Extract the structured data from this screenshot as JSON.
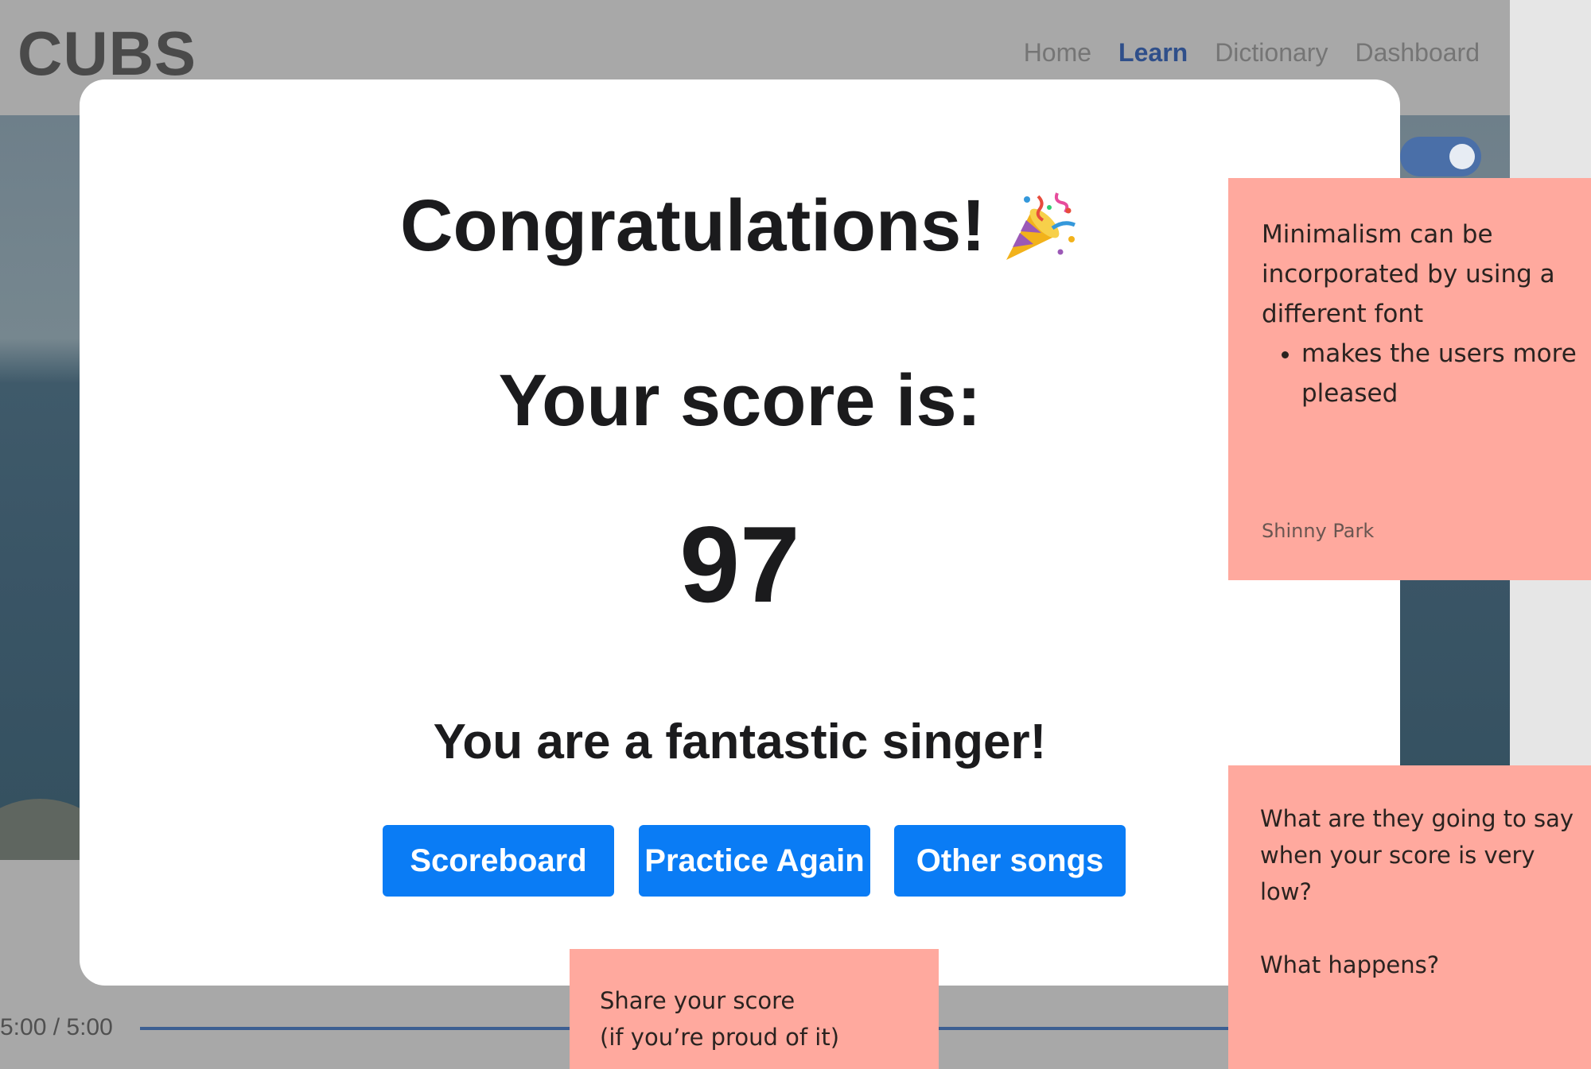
{
  "app": {
    "logo": "CUBS",
    "nav": [
      "Home",
      "Learn",
      "Dictionary",
      "Dashboard"
    ],
    "active_nav": "Learn",
    "playback_time": "5:00 / 5:00",
    "playback_progress": 1.0
  },
  "modal": {
    "title": "Congratulations!",
    "title_icon": "party-popper-icon",
    "score_label": "Your score is:",
    "score": "97",
    "message": "You are a fantastic singer!",
    "buttons": {
      "scoreboard": "Scoreboard",
      "practice_again": "Practice Again",
      "other_songs": "Other songs"
    }
  },
  "notes": {
    "note1": {
      "line1": "Minimalism can be",
      "line2": "incorporated by using a",
      "line3": "different font",
      "bullet_line1": "makes the users more",
      "bullet_line2": "pleased",
      "author": "Shinny Park"
    },
    "note2": {
      "line1": "What are they going to say",
      "line2": "when your score is very",
      "line3": "low?",
      "line4": "What happens?"
    },
    "note3": {
      "line1": "Share your score",
      "line2": "(if you’re proud of it)"
    }
  },
  "colors": {
    "button": "#0a7cf5",
    "sticky_note": "#ffa99e",
    "nav_active": "#2f4f8a",
    "overlay_gray": "#a8a8a8"
  }
}
